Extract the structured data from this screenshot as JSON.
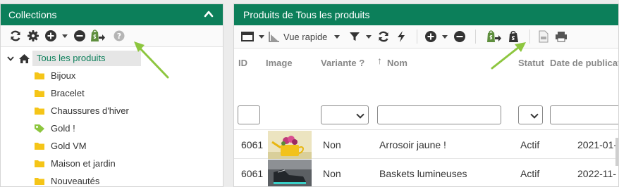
{
  "collections": {
    "title": "Collections",
    "toolbar_icons": [
      "refresh-icon",
      "gear-icon",
      "add-icon",
      "caret-icon",
      "remove-icon",
      "shopify-export-icon",
      "help-icon"
    ],
    "tree": {
      "root_label": "Tous les produits",
      "items": [
        {
          "label": "Bijoux",
          "icon": "folder-icon"
        },
        {
          "label": "Bracelet",
          "icon": "folder-icon"
        },
        {
          "label": "Chaussures d'hiver",
          "icon": "folder-icon"
        },
        {
          "label": "Gold !",
          "icon": "tag-icon"
        },
        {
          "label": "Gold VM",
          "icon": "folder-icon"
        },
        {
          "label": "Maison et jardin",
          "icon": "folder-icon"
        },
        {
          "label": "Nouveautés",
          "icon": "folder-icon"
        }
      ]
    }
  },
  "products": {
    "title": "Produits de Tous les produits",
    "toolbar": {
      "quick_view_label": "Vue rapide"
    },
    "columns": {
      "id": "ID",
      "image": "Image",
      "variant": "Variante ?",
      "name": "Nom",
      "status": "Statut",
      "publish_date": "Date de publicati"
    },
    "rows": [
      {
        "id": "6061",
        "variant": "Non",
        "name": "Arrosoir jaune !",
        "status": "Actif",
        "date": "2021-01-"
      },
      {
        "id": "6061",
        "variant": "Non",
        "name": "Baskets lumineuses",
        "status": "Actif",
        "date": "2022-11-"
      }
    ]
  },
  "colors": {
    "header_green": "#0c7f5a",
    "annotation_arrow": "#8dc63f",
    "folder_yellow": "#f5c518",
    "tag_green": "#8dc63f"
  }
}
